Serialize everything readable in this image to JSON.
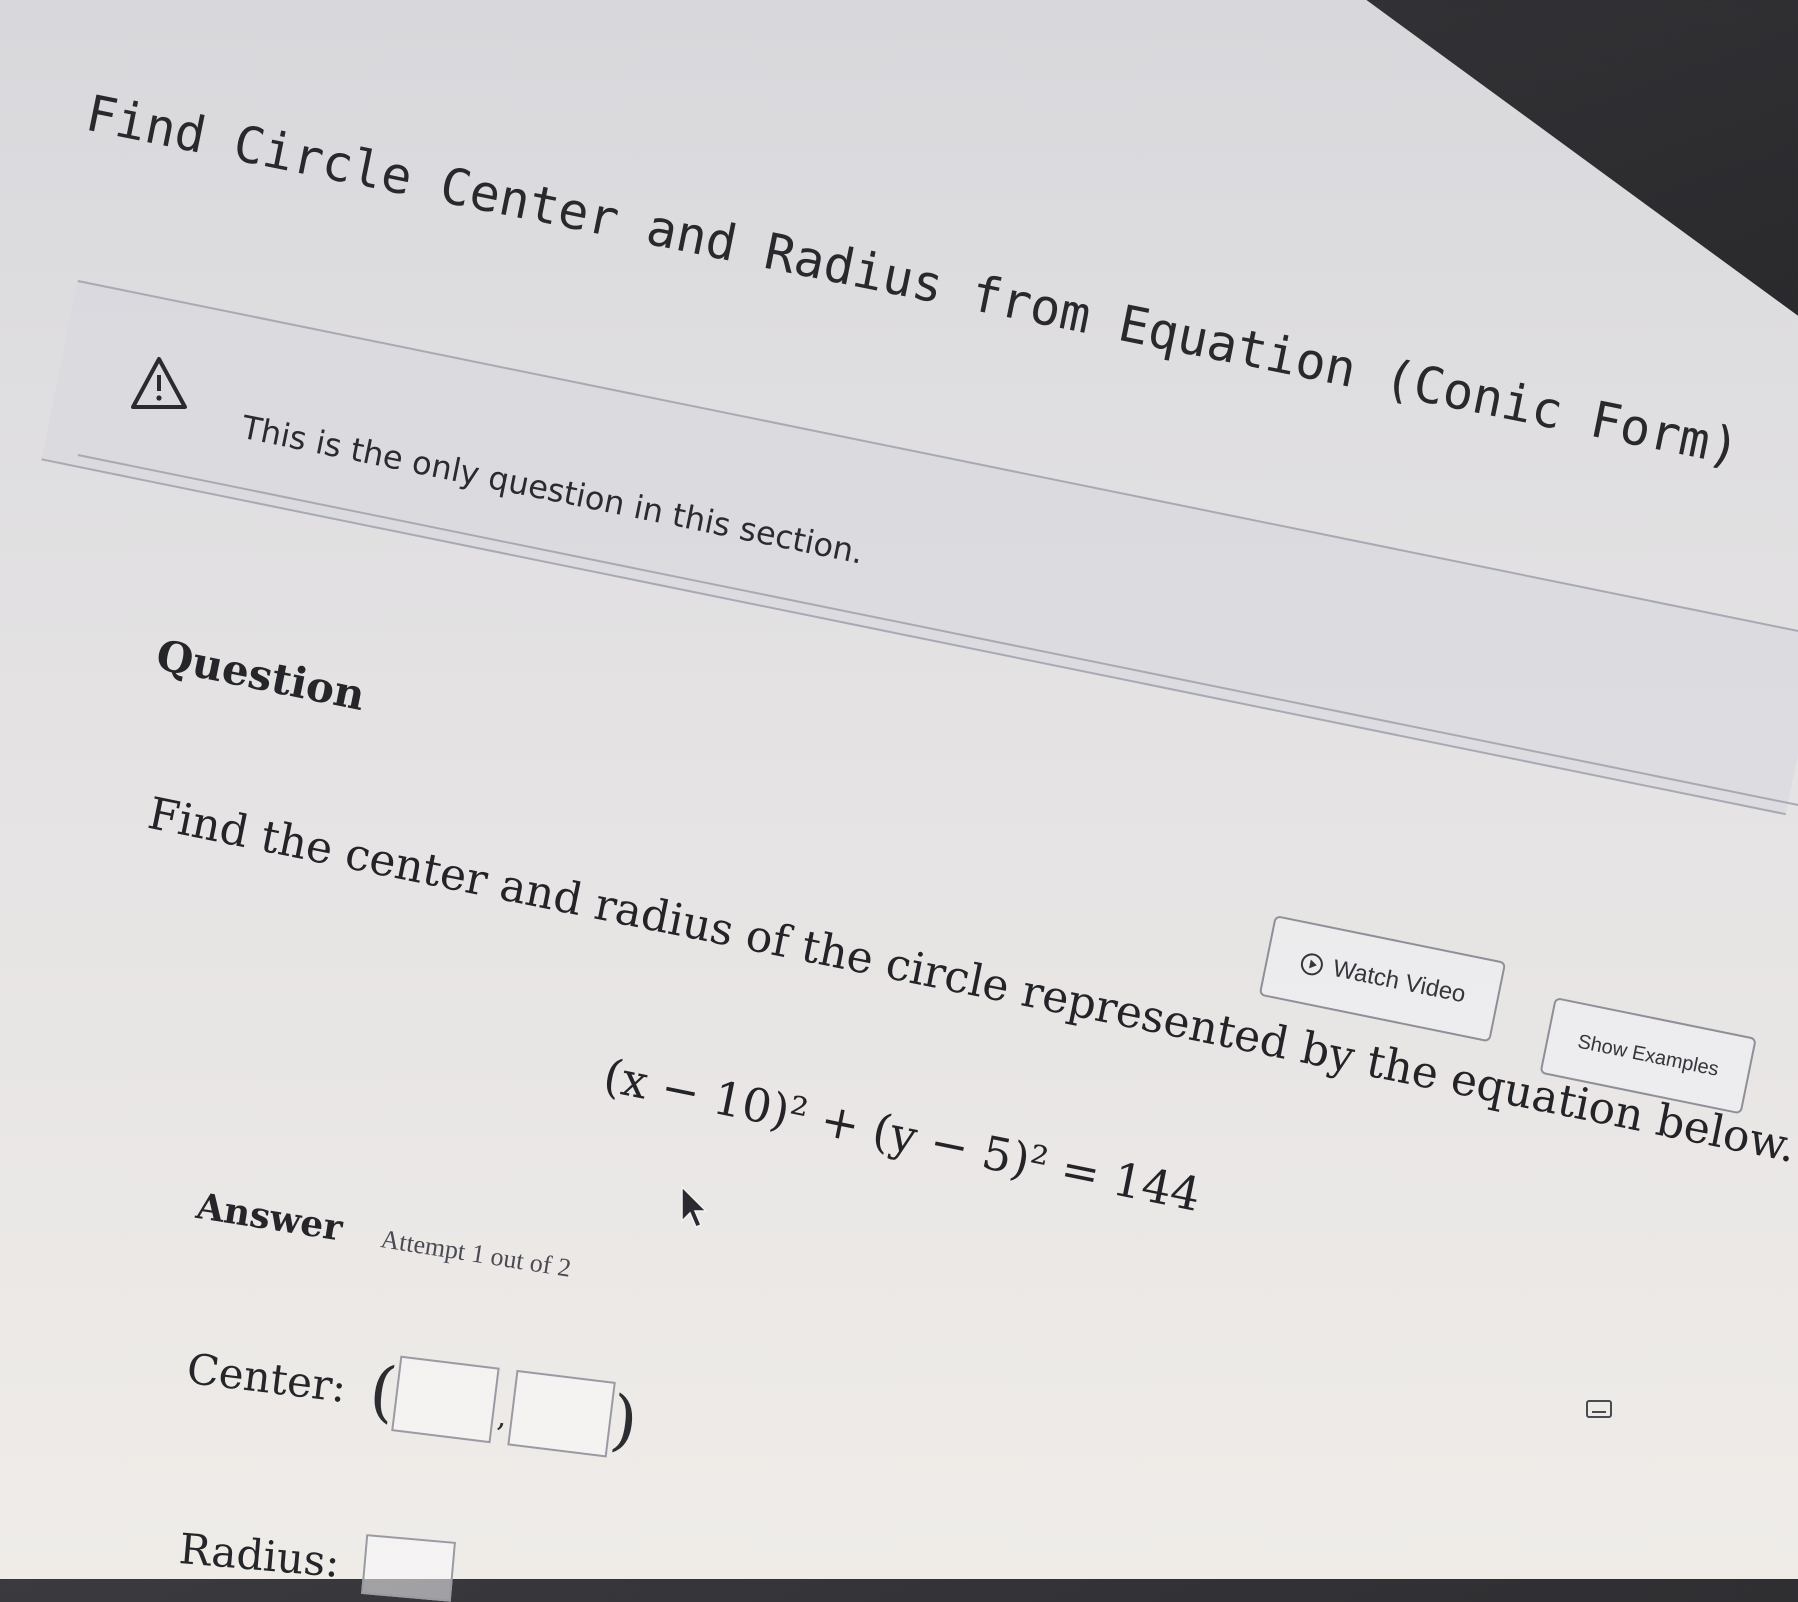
{
  "page": {
    "title": "Find Circle Center and Radius from Equation (Conic Form)"
  },
  "notice": {
    "icon": "warning-icon",
    "text": "This is the only question in this section."
  },
  "question": {
    "heading": "Question",
    "prompt": "Find the center and radius of the circle represented by the equation below.",
    "equation": "(x − 10)² + (y − 5)² = 144"
  },
  "buttons": {
    "watch_video_icon": "play-circle-icon",
    "watch_video_label": "Watch Video",
    "show_examples_label": "Show Examples"
  },
  "answer": {
    "heading": "Answer",
    "attempt_text": "Attempt 1 out of 2",
    "center_label": "Center:",
    "center_open_paren": "(",
    "center_separator": ",",
    "center_close_paren": ")",
    "center_x_value": "",
    "center_y_value": "",
    "radius_label": "Radius:",
    "radius_value": ""
  },
  "colors": {
    "text": "#232328",
    "border": "#8f8f98",
    "background": "#e4e2e3"
  }
}
